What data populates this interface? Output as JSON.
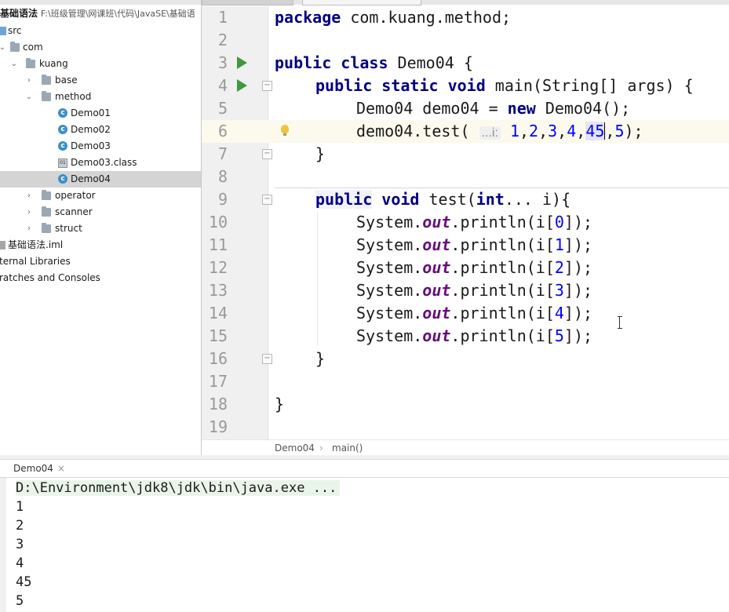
{
  "project": {
    "header": {
      "module": "基础语法",
      "path": "F:\\班级管理\\网课班\\代码\\JavaSE\\基础语"
    },
    "tree": [
      {
        "name": "src",
        "icon": "source-folder-icon",
        "level": 0
      },
      {
        "name": "com",
        "icon": "package-icon",
        "level": 1
      },
      {
        "name": "kuang",
        "icon": "package-icon",
        "level": 2,
        "expanded": true
      },
      {
        "name": "base",
        "icon": "package-icon",
        "level": 3,
        "expanded": false
      },
      {
        "name": "method",
        "icon": "package-icon",
        "level": 3,
        "expanded": true
      },
      {
        "name": "Demo01",
        "icon": "java-class-icon",
        "level": 4
      },
      {
        "name": "Demo02",
        "icon": "java-class-icon",
        "level": 4
      },
      {
        "name": "Demo03",
        "icon": "java-class-icon",
        "level": 4
      },
      {
        "name": "Demo03.class",
        "icon": "binary-file-icon",
        "level": 4
      },
      {
        "name": "Demo04",
        "icon": "java-class-icon",
        "level": 4,
        "selected": true
      },
      {
        "name": "operator",
        "icon": "package-icon",
        "level": 3,
        "expanded": false
      },
      {
        "name": "scanner",
        "icon": "package-icon",
        "level": 3,
        "expanded": false
      },
      {
        "name": "struct",
        "icon": "package-icon",
        "level": 3,
        "expanded": false
      },
      {
        "name": "基础语法.iml",
        "icon": "module-file-icon",
        "level": 0
      },
      {
        "name": "ternal Libraries",
        "icon": "",
        "level": -1
      },
      {
        "name": "ratches and Consoles",
        "icon": "",
        "level": -1
      }
    ]
  },
  "editor": {
    "line_numbers": [
      "1",
      "2",
      "3",
      "4",
      "5",
      "6",
      "7",
      "8",
      "9",
      "10",
      "11",
      "12",
      "13",
      "14",
      "15",
      "16",
      "17",
      "18",
      "19"
    ],
    "code": {
      "l1_kw": "package",
      "l1_rest": " com.kuang.method;",
      "l3_kw": "public class",
      "l3_rest": " Demo04 {",
      "l4_kw1": "public static void",
      "l4_rest": " main(String[] args) {",
      "l5_a": "Demo04 demo04 = ",
      "l5_kw": "new",
      "l5_b": " Demo04();",
      "l6_a": "demo04.test( ",
      "l6_hint": "...i:",
      "l6_b": " ",
      "l6_n1": "1",
      "l6_c1": ",",
      "l6_n2": "2",
      "l6_c2": ",",
      "l6_n3": "3",
      "l6_c3": ",",
      "l6_n4": "4",
      "l6_c4": ",",
      "l6_n5": "45",
      "l6_c5": ",",
      "l6_n6": "5",
      "l6_end": ");",
      "l7": "}",
      "l9_kw1": "public",
      "l9_kw2": "void",
      "l9_a": " test(",
      "l9_kw3": "int",
      "l9_b": "... i){",
      "sys": "System.",
      "out": "out",
      "println": ".println(i[",
      "close": "]);",
      "idx": [
        "0",
        "1",
        "2",
        "3",
        "4",
        "5"
      ],
      "l16": "}",
      "l18": "}"
    },
    "breadcrumbs": [
      "Demo04",
      "main()"
    ]
  },
  "run": {
    "tab_label": "Demo04",
    "command": "D:\\Environment\\jdk8\\jdk\\bin\\java.exe ...",
    "output": [
      "1",
      "2",
      "3",
      "4",
      "45",
      "5"
    ]
  }
}
